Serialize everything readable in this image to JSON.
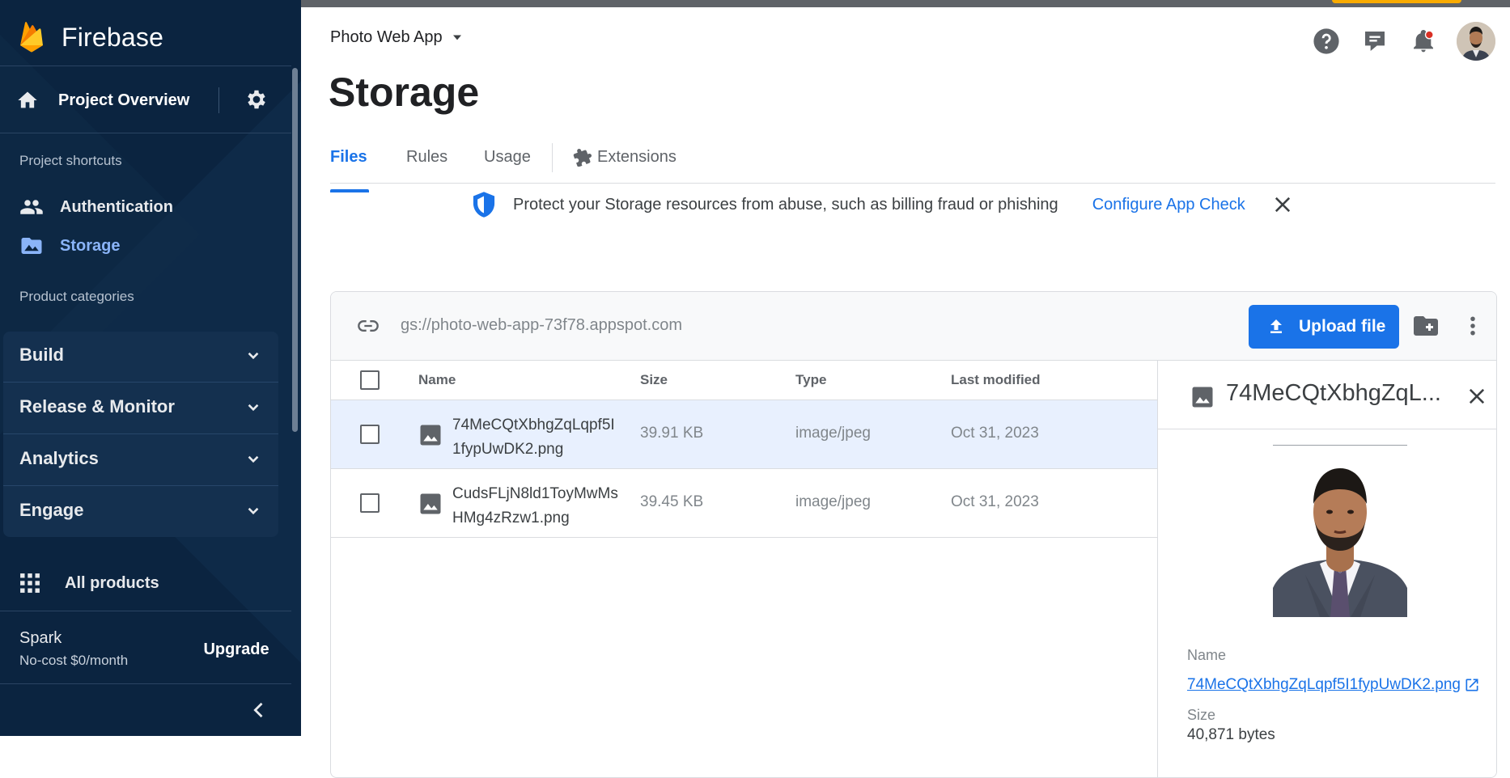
{
  "sidebar": {
    "brand": "Firebase",
    "project_overview": "Project Overview",
    "shortcuts_label": "Project shortcuts",
    "shortcuts": [
      {
        "label": "Authentication",
        "icon": "people-icon"
      },
      {
        "label": "Storage",
        "icon": "photo-folder-icon",
        "active": true
      }
    ],
    "categories_label": "Product categories",
    "categories": [
      "Build",
      "Release & Monitor",
      "Analytics",
      "Engage"
    ],
    "all_products": "All products",
    "plan": "Spark",
    "plan_cost": "No-cost $0/month",
    "upgrade": "Upgrade"
  },
  "header": {
    "project_name": "Photo Web App",
    "icons": [
      "help-icon",
      "feedback-icon",
      "notifications-icon",
      "avatar"
    ]
  },
  "page": {
    "title": "Storage",
    "tabs": [
      {
        "label": "Files",
        "active": true
      },
      {
        "label": "Rules"
      },
      {
        "label": "Usage"
      },
      {
        "label": "Extensions",
        "icon": "puzzle-icon"
      }
    ]
  },
  "banner": {
    "message": "Protect your Storage resources from abuse, such as billing fraud or phishing",
    "link": "Configure App Check"
  },
  "storage": {
    "bucket": "gs://photo-web-app-73f78.appspot.com",
    "upload_label": "Upload file",
    "columns": [
      "Name",
      "Size",
      "Type",
      "Last modified"
    ],
    "files": [
      {
        "name": "74MeCQtXbhgZqLqpf5I1fypUwDK2.png",
        "size": "39.91 KB",
        "type": "image/jpeg",
        "modified": "Oct 31, 2023",
        "selected": true
      },
      {
        "name": "CudsFLjN8ld1ToyMwMsHMg4zRzw1.png",
        "size": "39.45 KB",
        "type": "image/jpeg",
        "modified": "Oct 31, 2023",
        "selected": false
      }
    ]
  },
  "detail": {
    "title": "74MeCQtXbhgZqL...",
    "name_label": "Name",
    "name_value": "74MeCQtXbhgZqLqpf5I1fypUwDK2.png",
    "size_label": "Size",
    "size_value": "40,871 bytes"
  },
  "colors": {
    "sidebar_bg": "#0b2440",
    "accent": "#1a73e8",
    "selected_row": "#e8f0fe",
    "active_nav": "#8ab4f8"
  }
}
